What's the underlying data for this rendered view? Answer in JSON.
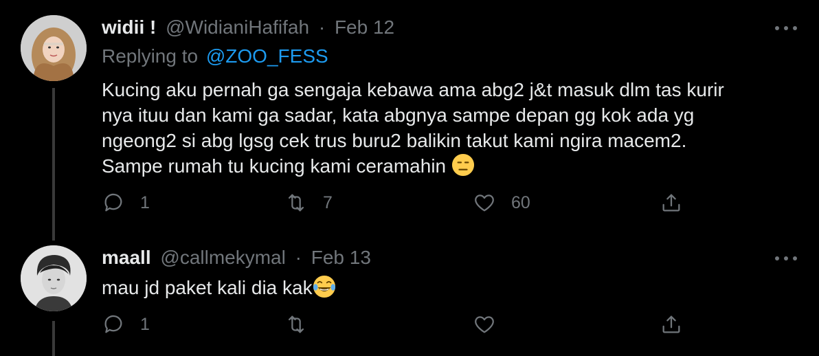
{
  "tweets": [
    {
      "name": "widii !",
      "handle": "@WidianiHafifah",
      "separator": "·",
      "date": "Feb 12",
      "replying_prefix": "Replying to",
      "replying_to": "@ZOO_FESS",
      "text": "Kucing aku pernah ga sengaja kebawa ama abg2 j&t masuk dlm tas kurir\nnya ituu dan kami ga sadar, kata abgnya sampe depan gg kok ada yg\nngeong2 si abg lgsg cek trus buru2 balikin takut kami ngira macem2.\nSampe rumah tu kucing kami ceramahin",
      "emoji": "expressionless-face-icon",
      "replies": "1",
      "retweets": "7",
      "likes": "60",
      "avatar": "avatar-woman-hijab"
    },
    {
      "name": "maall",
      "handle": "@callmekymal",
      "separator": "·",
      "date": "Feb 13",
      "text": "mau jd paket kali dia kak",
      "emoji": "face-with-tears-of-joy-icon",
      "replies": "1",
      "retweets": "",
      "likes": "",
      "avatar": "avatar-man-monochrome"
    }
  ],
  "colors": {
    "background": "#000000",
    "name": "#e7e9ea",
    "secondary": "#71767b",
    "mention": "#1d9bf0",
    "thread_line": "#3a3a3a"
  }
}
